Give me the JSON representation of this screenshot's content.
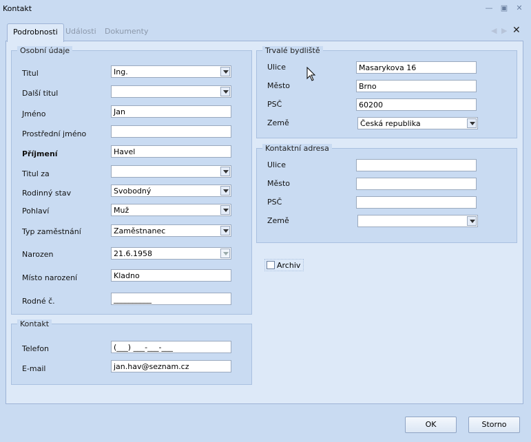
{
  "window": {
    "title": "Kontakt"
  },
  "tabs": [
    {
      "label": "Podrobnosti"
    },
    {
      "label": "Události"
    },
    {
      "label": "Dokumenty"
    }
  ],
  "osobni": {
    "legend": "Osobní údaje",
    "titul": {
      "label": "Titul",
      "value": "Ing."
    },
    "dalsi_titul": {
      "label": "Další titul",
      "value": ""
    },
    "jmeno": {
      "label": "Jméno",
      "value": "Jan"
    },
    "prostredni": {
      "label": "Prostřední jméno",
      "value": ""
    },
    "prijmeni": {
      "label": "Příjmení",
      "value": "Havel"
    },
    "titul_za": {
      "label": "Titul za",
      "value": ""
    },
    "rodinny_stav": {
      "label": "Rodinný stav",
      "value": "Svobodný"
    },
    "pohlavi": {
      "label": "Pohlaví",
      "value": "Muž"
    },
    "typ_zamestnani": {
      "label": "Typ zaměstnání",
      "value": "Zaměstnanec"
    },
    "narozen": {
      "label": "Narozen",
      "value": "21.6.1958"
    },
    "misto_narozeni": {
      "label": "Místo narození",
      "value": "Kladno"
    },
    "rodne_c": {
      "label": "Rodné č.",
      "value": "__________"
    }
  },
  "kontakt": {
    "legend": "Kontakt",
    "telefon": {
      "label": "Telefon",
      "value": "(___) ___-___-___"
    },
    "email": {
      "label": "E-mail",
      "value": "jan.hav@seznam.cz"
    }
  },
  "trvale": {
    "legend": "Trvalé bydliště",
    "ulice": {
      "label": "Ulice",
      "value": "Masarykova 16"
    },
    "mesto": {
      "label": "Město",
      "value": "Brno"
    },
    "psc": {
      "label": "PSČ",
      "value": "60200"
    },
    "zeme": {
      "label": "Země",
      "value": "Česká republika"
    }
  },
  "kontaktni": {
    "legend": "Kontaktní adresa",
    "ulice": {
      "label": "Ulice",
      "value": ""
    },
    "mesto": {
      "label": "Město",
      "value": ""
    },
    "psc": {
      "label": "PSČ",
      "value": ""
    },
    "zeme": {
      "label": "Země",
      "value": ""
    }
  },
  "archiv": {
    "label": "Archiv",
    "checked": false
  },
  "buttons": {
    "ok": "OK",
    "storno": "Storno"
  },
  "icons": {
    "minimize": "minimize-icon",
    "restore": "restore-icon",
    "close": "close-icon",
    "tab_prev": "arrow-left-icon",
    "tab_next": "arrow-right-icon",
    "tab_close": "close-icon"
  }
}
